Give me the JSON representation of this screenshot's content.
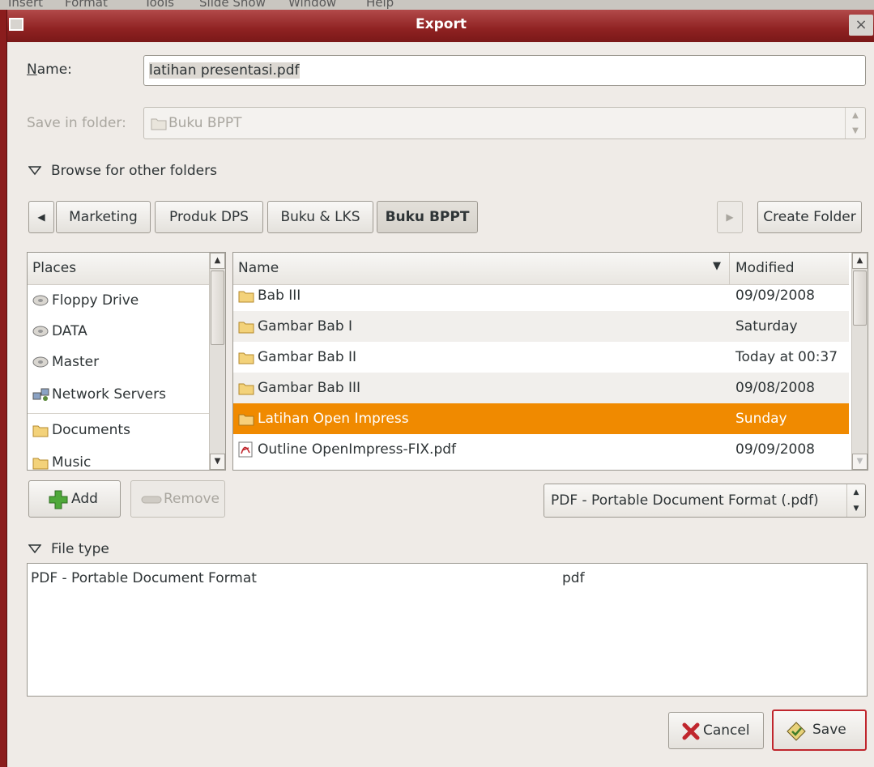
{
  "background_menu": [
    "Insert",
    "Format",
    "Tools",
    "Slide Show",
    "Window",
    "Help"
  ],
  "window": {
    "title": "Export",
    "close_glyph": "×"
  },
  "name_field": {
    "label": "Name:",
    "value": "latihan presentasi.pdf"
  },
  "save_in": {
    "label": "Save in folder:",
    "value": "Buku BPPT"
  },
  "browse": {
    "label": "Browse for other folders"
  },
  "path_bar": {
    "crumbs": [
      "Marketing",
      "Produk DPS",
      "Buku & LKS",
      "Buku BPPT"
    ],
    "active_index": 3,
    "create_folder": "Create Folder"
  },
  "places": {
    "header": "Places",
    "items": [
      {
        "label": "Floppy Drive",
        "icon": "drive-icon"
      },
      {
        "label": "DATA",
        "icon": "drive-icon"
      },
      {
        "label": "Master",
        "icon": "drive-icon"
      },
      {
        "label": "Network Servers",
        "icon": "network-icon"
      },
      {
        "label": "Documents",
        "icon": "folder-icon"
      },
      {
        "label": "Music",
        "icon": "folder-icon"
      }
    ]
  },
  "files": {
    "col_name": "Name",
    "col_modified": "Modified",
    "rows": [
      {
        "name": "Bab III",
        "modified": "09/09/2008",
        "icon": "folder-icon"
      },
      {
        "name": "Gambar Bab I",
        "modified": "Saturday",
        "icon": "folder-icon"
      },
      {
        "name": "Gambar Bab II",
        "modified": "Today at 00:37",
        "icon": "folder-icon"
      },
      {
        "name": "Gambar Bab III",
        "modified": "09/08/2008",
        "icon": "folder-icon"
      },
      {
        "name": "Latihan Open Impress",
        "modified": "Sunday",
        "icon": "folder-icon",
        "selected": true
      },
      {
        "name": "Outline OpenImpress-FIX.pdf",
        "modified": "09/09/2008",
        "icon": "pdf-icon"
      }
    ]
  },
  "buttons": {
    "add": "Add",
    "remove": "Remove",
    "cancel": "Cancel",
    "save": "Save"
  },
  "filter": {
    "value": "PDF - Portable Document Format (.pdf)"
  },
  "file_type": {
    "label": "File type",
    "rows": [
      {
        "name": "PDF - Portable Document Format",
        "ext": "pdf"
      }
    ]
  },
  "colors": {
    "selection": "#f08a00",
    "titlebar": "#8f2222",
    "accent_save_border": "#c0262d"
  }
}
